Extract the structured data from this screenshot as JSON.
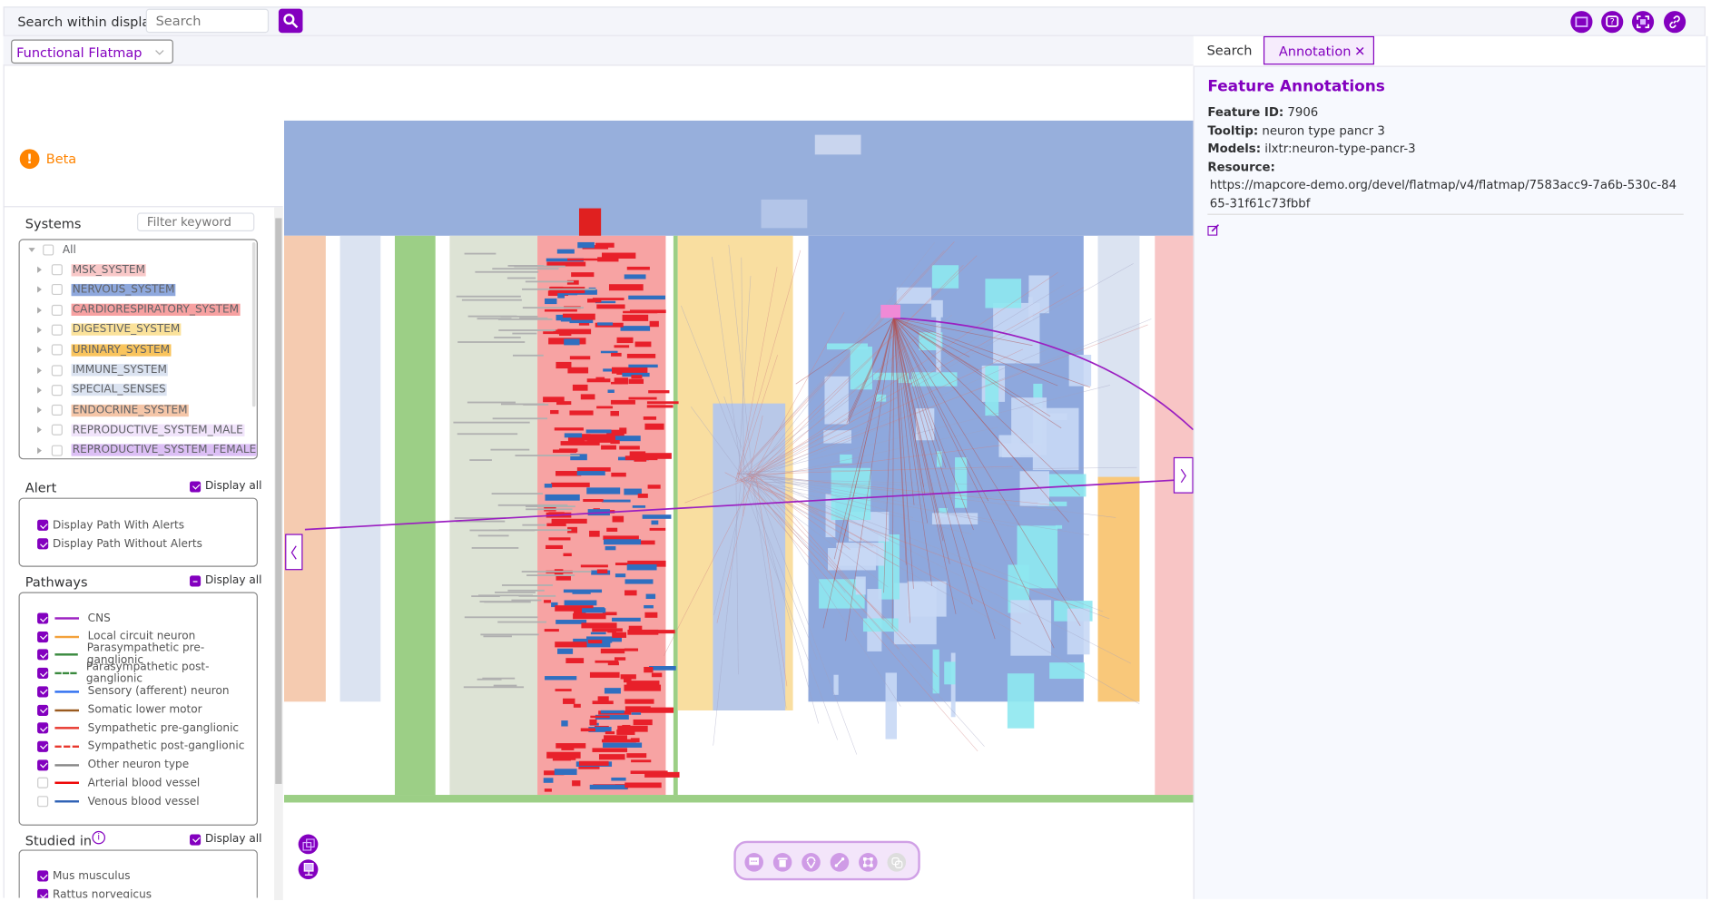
{
  "topbar": {
    "search_label": "Search within display",
    "search_placeholder": "Search",
    "icons": [
      "search-icon",
      "display-icon",
      "help-icon",
      "fullscreen-icon",
      "link-icon"
    ]
  },
  "map_selector": {
    "selected": "Functional Flatmap"
  },
  "beta": {
    "label": "Beta"
  },
  "systems": {
    "title": "Systems",
    "filter_placeholder": "Filter keyword",
    "all_label": "All",
    "items": [
      {
        "label": "MSK_SYSTEM",
        "color": "#f9c8c8"
      },
      {
        "label": "NERVOUS_SYSTEM",
        "color": "#8ea8dd"
      },
      {
        "label": "CARDIORESPIRATORY_SYSTEM",
        "color": "#f7a1a1"
      },
      {
        "label": "DIGESTIVE_SYSTEM",
        "color": "#fbe29a"
      },
      {
        "label": "URINARY_SYSTEM",
        "color": "#f9c45d"
      },
      {
        "label": "IMMUNE_SYSTEM",
        "color": "#dbe3f1"
      },
      {
        "label": "SPECIAL_SENSES",
        "color": "#dbe3f1"
      },
      {
        "label": "ENDOCRINE_SYSTEM",
        "color": "#f5c6a8"
      },
      {
        "label": "REPRODUCTIVE_SYSTEM_MALE",
        "color": "#f1e4fb"
      },
      {
        "label": "REPRODUCTIVE_SYSTEM_FEMALE",
        "color": "#dcbff5"
      }
    ]
  },
  "alert": {
    "title": "Alert",
    "display_all": "Display all",
    "items": [
      {
        "label": "Display Path With Alerts",
        "checked": true
      },
      {
        "label": "Display Path Without Alerts",
        "checked": true
      }
    ]
  },
  "pathways": {
    "title": "Pathways",
    "display_all": "Display all",
    "items": [
      {
        "label": "CNS",
        "color": "#9b1fc1",
        "dashed": false,
        "checked": true
      },
      {
        "label": "Local circuit neuron",
        "color": "#f3a13b",
        "dashed": false,
        "checked": true
      },
      {
        "label": "Parasympathetic pre-ganglionic",
        "color": "#3a8a3f",
        "dashed": false,
        "checked": true
      },
      {
        "label": "Parasympathetic post-ganglionic",
        "color": "#3a8a3f",
        "dashed": true,
        "checked": true
      },
      {
        "label": "Sensory (afferent) neuron",
        "color": "#2f6ff0",
        "dashed": false,
        "checked": true
      },
      {
        "label": "Somatic lower motor",
        "color": "#9a5a1f",
        "dashed": false,
        "checked": true
      },
      {
        "label": "Sympathetic pre-ganglionic",
        "color": "#e8382e",
        "dashed": false,
        "checked": true
      },
      {
        "label": "Sympathetic post-ganglionic",
        "color": "#e8382e",
        "dashed": true,
        "checked": true
      },
      {
        "label": "Other neuron type",
        "color": "#888888",
        "dashed": false,
        "checked": true
      },
      {
        "label": "Arterial blood vessel",
        "color": "#ee0000",
        "dashed": false,
        "checked": false
      },
      {
        "label": "Venous blood vessel",
        "color": "#2e62b5",
        "dashed": false,
        "checked": false
      }
    ]
  },
  "studied_in": {
    "title": "Studied in",
    "display_all": "Display all",
    "items": [
      {
        "label": "Mus musculus",
        "checked": true
      },
      {
        "label": "Rattus norvegicus",
        "checked": true
      }
    ]
  },
  "right_panel": {
    "tabs": [
      {
        "label": "Search"
      },
      {
        "label": "Annotation",
        "active": true
      }
    ],
    "heading": "Feature Annotations",
    "feature_id_label": "Feature ID:",
    "feature_id": "7906",
    "tooltip_label": "Tooltip:",
    "tooltip": "neuron type pancr 3",
    "models_label": "Models:",
    "models": "ilxtr:neuron-type-pancr-3",
    "resource_label": "Resource:",
    "resource": "https://mapcore-demo.org/devel/flatmap/v4/flatmap/7583acc9-7a6b-530c-8465-31f61c73fbbf"
  },
  "map_tools": [
    "comment-icon",
    "delete-icon",
    "point-icon",
    "line-icon",
    "polygon-icon",
    "connection-icon"
  ],
  "colors": {
    "accent": "#8300bf",
    "beta": "#ff8400"
  }
}
